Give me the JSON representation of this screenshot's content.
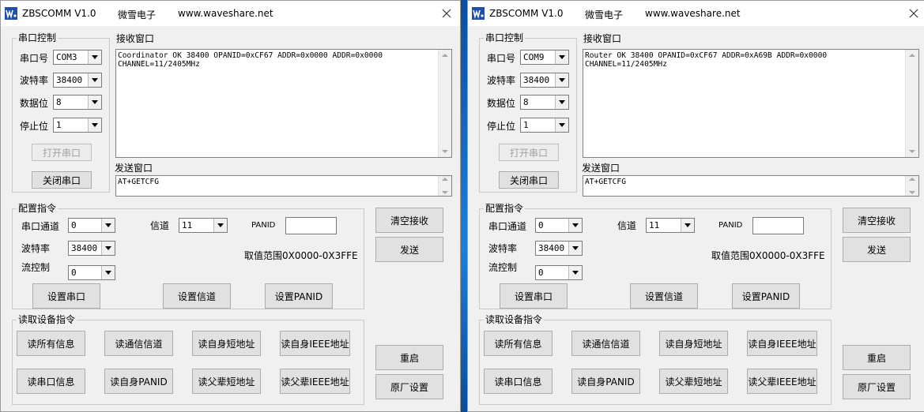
{
  "windows": [
    {
      "title": {
        "app": "ZBSCOMM V1.0",
        "company": "微雪电子",
        "url": "www.waveshare.net"
      },
      "serial": {
        "group": "串口控制",
        "port_label": "串口号",
        "port_value": "COM3",
        "baud_label": "波特率",
        "baud_value": "38400",
        "data_label": "数据位",
        "data_value": "8",
        "stop_label": "停止位",
        "stop_value": "1",
        "open_btn": "打开串口",
        "close_btn": "关闭串口"
      },
      "receive": {
        "label": "接收窗口",
        "text": "Coordinator OK 38400 OPANID=0xCF67 ADDR=0x0000 ADDR=0x0000\nCHANNEL=11/2405MHz"
      },
      "send": {
        "label": "发送窗口",
        "text": "AT+GETCFG"
      },
      "config": {
        "group": "配置指令",
        "channel_label": "串口通道",
        "channel_value": "0",
        "baud_label": "波特率",
        "baud_value": "38400",
        "flow_label": "流控制",
        "flow_value": "0",
        "rf_label": "信道",
        "rf_value": "11",
        "panid_label": "PANID",
        "panid_value": "",
        "range_text": "取值范围0X0000-0X3FFE",
        "set_serial_btn": "设置串口",
        "set_channel_btn": "设置信道",
        "set_panid_btn": "设置PANID"
      },
      "read": {
        "group": "读取设备指令",
        "buttons": [
          "读所有信息",
          "读通信信道",
          "读自身短地址",
          "读自身IEEE地址",
          "读串口信息",
          "读自身PANID",
          "读父辈短地址",
          "读父辈IEEE地址"
        ]
      },
      "right_buttons": {
        "clear": "清空接收",
        "send": "发送",
        "restart": "重启",
        "factory": "原厂设置"
      }
    },
    {
      "title": {
        "app": "ZBSCOMM V1.0",
        "company": "微雪电子",
        "url": "www.waveshare.net"
      },
      "serial": {
        "group": "串口控制",
        "port_label": "串口号",
        "port_value": "COM9",
        "baud_label": "波特率",
        "baud_value": "38400",
        "data_label": "数据位",
        "data_value": "8",
        "stop_label": "停止位",
        "stop_value": "1",
        "open_btn": "打开串口",
        "close_btn": "关闭串口"
      },
      "receive": {
        "label": "接收窗口",
        "text": "Router OK 38400 OPANID=0xCF67 ADDR=0xA69B ADDR=0x0000\nCHANNEL=11/2405MHz"
      },
      "send": {
        "label": "发送窗口",
        "text": "AT+GETCFG"
      },
      "config": {
        "group": "配置指令",
        "channel_label": "串口通道",
        "channel_value": "0",
        "baud_label": "波特率",
        "baud_value": "38400",
        "flow_label": "流控制",
        "flow_value": "0",
        "rf_label": "信道",
        "rf_value": "11",
        "panid_label": "PANID",
        "panid_value": "",
        "range_text": "取值范围0X0000-0X3FFE",
        "set_serial_btn": "设置串口",
        "set_channel_btn": "设置信道",
        "set_panid_btn": "设置PANID"
      },
      "read": {
        "group": "读取设备指令",
        "buttons": [
          "读所有信息",
          "读通信信道",
          "读自身短地址",
          "读自身IEEE地址",
          "读串口信息",
          "读自身PANID",
          "读父辈短地址",
          "读父辈IEEE地址"
        ]
      },
      "right_buttons": {
        "clear": "清空接收",
        "send": "发送",
        "restart": "重启",
        "factory": "原厂设置"
      }
    }
  ]
}
